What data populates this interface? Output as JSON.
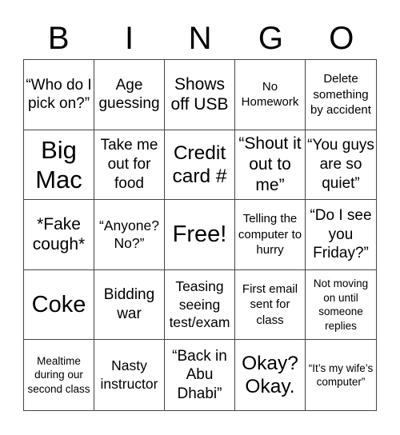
{
  "header": [
    "B",
    "I",
    "N",
    "G",
    "O"
  ],
  "cells": [
    {
      "text": "“Who do I pick on?”",
      "size": "s19"
    },
    {
      "text": "Age guessing",
      "size": "s19"
    },
    {
      "text": "Shows off USB",
      "size": "s22"
    },
    {
      "text": "No Homework",
      "size": "s15"
    },
    {
      "text": "Delete something by accident",
      "size": "s15"
    },
    {
      "text": "Big Mac",
      "size": "s31"
    },
    {
      "text": "Take me out for food",
      "size": "s19"
    },
    {
      "text": "Credit card #",
      "size": "s25"
    },
    {
      "text": "“Shout it out to me”",
      "size": "s22"
    },
    {
      "text": "“You guys are so quiet”",
      "size": "s19"
    },
    {
      "text": "*Fake cough*",
      "size": "s22"
    },
    {
      "text": "“Anyone? No?”",
      "size": "s17"
    },
    {
      "text": "Free!",
      "size": "s29"
    },
    {
      "text": "Telling the computer to hurry",
      "size": "s15"
    },
    {
      "text": "“Do I see you Friday?”",
      "size": "s19"
    },
    {
      "text": "Coke",
      "size": "s29"
    },
    {
      "text": "Bidding war",
      "size": "s19"
    },
    {
      "text": "Teasing seeing test/exam",
      "size": "s17"
    },
    {
      "text": "First email sent for class",
      "size": "s15"
    },
    {
      "text": "Not moving on until someone replies",
      "size": "s13"
    },
    {
      "text": "Mealtime during our second class",
      "size": "s13"
    },
    {
      "text": "Nasty instructor",
      "size": "s17"
    },
    {
      "text": "“Back in Abu Dhabi”",
      "size": "s19"
    },
    {
      "text": "Okay? Okay.",
      "size": "s25"
    },
    {
      "text": "“It’s my wife’s computer”",
      "size": "s13"
    }
  ]
}
